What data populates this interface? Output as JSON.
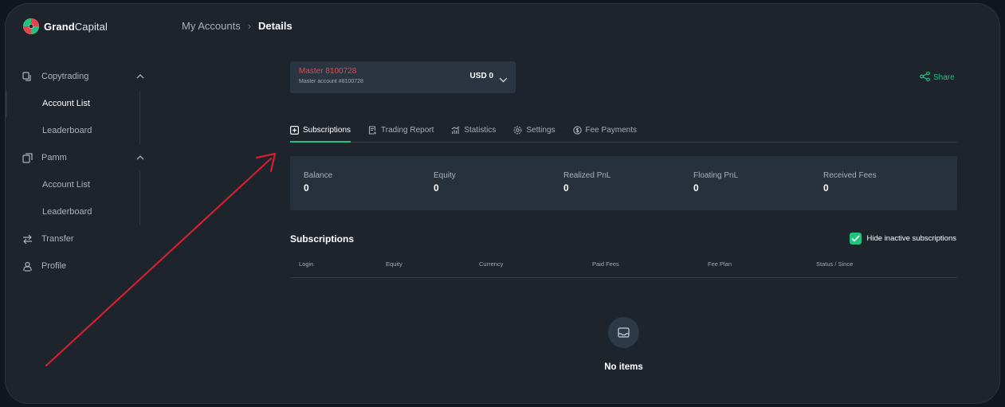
{
  "brand": {
    "bold": "Grand",
    "light": "Capital"
  },
  "breadcrumb": {
    "parent": "My Accounts",
    "separator": "›",
    "current": "Details"
  },
  "sidebar": {
    "groups": [
      {
        "label": "Copytrading",
        "icon": "copytrading-icon",
        "expanded": true,
        "items": [
          {
            "label": "Account List",
            "active": true
          },
          {
            "label": "Leaderboard",
            "active": false
          }
        ]
      },
      {
        "label": "Pamm",
        "icon": "pamm-icon",
        "expanded": true,
        "items": [
          {
            "label": "Account List",
            "active": false
          },
          {
            "label": "Leaderboard",
            "active": false
          }
        ]
      }
    ],
    "links": [
      {
        "label": "Transfer",
        "icon": "transfer-icon"
      },
      {
        "label": "Profile",
        "icon": "profile-icon"
      }
    ]
  },
  "account": {
    "name": "Master 8100728",
    "subtitle": "Master account #8100728",
    "balance": "USD 0"
  },
  "share_label": "Share",
  "tabs": [
    {
      "label": "Subscriptions",
      "icon": "plus-square-icon",
      "active": true
    },
    {
      "label": "Trading Report",
      "icon": "report-icon",
      "active": false
    },
    {
      "label": "Statistics",
      "icon": "statistics-icon",
      "active": false
    },
    {
      "label": "Settings",
      "icon": "settings-icon",
      "active": false
    },
    {
      "label": "Fee Payments",
      "icon": "coin-icon",
      "active": false
    }
  ],
  "stats": [
    {
      "label": "Balance",
      "value": "0"
    },
    {
      "label": "Equity",
      "value": "0"
    },
    {
      "label": "Realized PnL",
      "value": "0"
    },
    {
      "label": "Floating PnL",
      "value": "0"
    },
    {
      "label": "Received Fees",
      "value": "0"
    }
  ],
  "subscriptions": {
    "title": "Subscriptions",
    "hide_inactive_label": "Hide inactive subscriptions",
    "hide_inactive_checked": true,
    "columns": [
      "Login",
      "Equity",
      "Currency",
      "Paid Fees",
      "Fee Plan",
      "Status / Since"
    ],
    "empty_text": "No items"
  },
  "colors": {
    "accent": "#20c27d",
    "account_name": "#e0474c",
    "annotation_arrow": "#d3202f"
  }
}
